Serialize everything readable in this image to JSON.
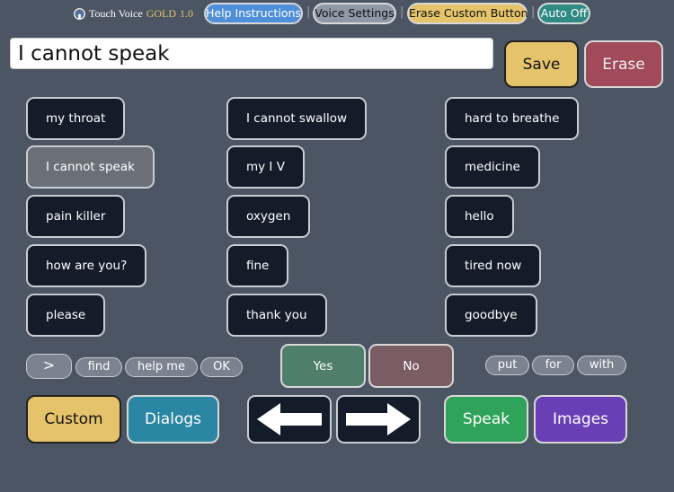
{
  "header": {
    "brand_name": "Touch Voice",
    "brand_edition": "GOLD",
    "brand_version": "1.0",
    "logo_icon": "touch-logo-icon",
    "buttons": {
      "help": "Help Instructions",
      "voice_settings": "Voice Settings",
      "erase_custom": "Erase Custom Button",
      "auto_off": "Auto Off"
    },
    "separator": "|"
  },
  "input": {
    "value": "I cannot speak",
    "save_label": "Save",
    "erase_label": "Erase"
  },
  "phrases": {
    "col1": [
      "my throat",
      "I cannot speak",
      "pain killer",
      "how are you?",
      "please"
    ],
    "col2": [
      "I cannot swallow",
      "my I V",
      "oxygen",
      "fine",
      "thank you"
    ],
    "col3": [
      "hard to breathe",
      "medicine",
      "hello",
      "tired now",
      "goodbye"
    ],
    "selected": "I cannot speak"
  },
  "words": {
    "next": ">",
    "find": "find",
    "help_me": "help me",
    "ok": "OK",
    "put": "put",
    "for": "for",
    "with": "with"
  },
  "answers": {
    "yes": "Yes",
    "no": "No"
  },
  "bottom": {
    "custom": "Custom",
    "dialogs": "Dialogs",
    "back_icon": "arrow-left-icon",
    "forward_icon": "arrow-right-icon",
    "speak": "Speak",
    "images": "Images"
  },
  "colors": {
    "background": "#4b5563",
    "phrase_bg": "#141c2a",
    "gold": "#e5c36b",
    "erase": "#a04a5a",
    "help": "#4f8fd9",
    "teal": "#2f8a83",
    "speak": "#2fa35a",
    "images": "#6a3fb5",
    "dialogs": "#2b86a3",
    "yes": "#4f7f6a",
    "no": "#7a5c64"
  }
}
